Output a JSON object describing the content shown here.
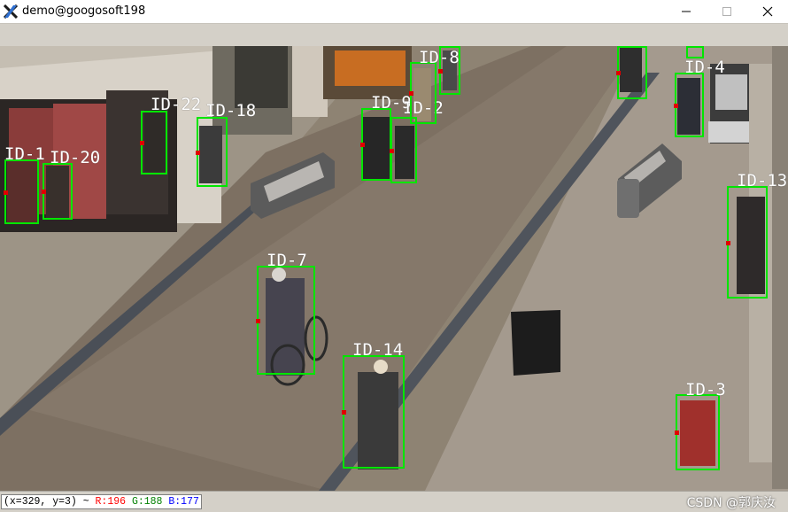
{
  "window": {
    "title": "demo@googosoft198",
    "controls": [
      "minimize-icon",
      "maximize-icon",
      "close-icon"
    ]
  },
  "detections": [
    {
      "id": "ID-1"
    },
    {
      "id": "ID-20"
    },
    {
      "id": "ID-22"
    },
    {
      "id": "ID-18"
    },
    {
      "id": "ID-9"
    },
    {
      "id": "ID-2"
    },
    {
      "id": "ID-8"
    },
    {
      "id": "ID-4"
    },
    {
      "id": "ID-13"
    },
    {
      "id": "ID-7"
    },
    {
      "id": "ID-14"
    },
    {
      "id": "ID-3"
    }
  ],
  "status": {
    "coords": "(x=329, y=3) ~",
    "r": "R:196",
    "g": "G:188",
    "b": "B:177"
  },
  "watermark": "CSDN @郭庆汝",
  "colors": {
    "box": "#00e600",
    "anchor": "#e00000",
    "r": "#ff0000",
    "g": "#008000",
    "b": "#0000ff"
  }
}
